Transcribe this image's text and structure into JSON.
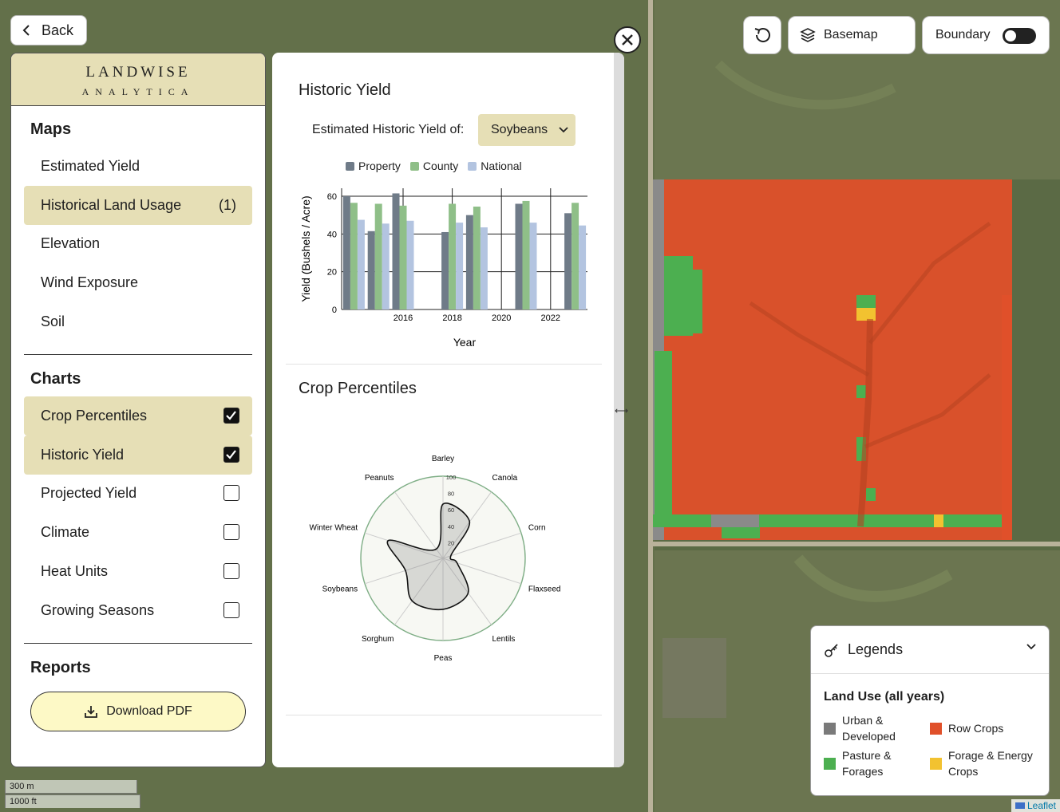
{
  "nav": {
    "back_label": "Back",
    "basemap_label": "Basemap",
    "boundary_label": "Boundary"
  },
  "logo": {
    "line1": "LANDWISE",
    "line2": "ANALYTICA"
  },
  "sidebar": {
    "maps_title": "Maps",
    "maps": [
      {
        "label": "Estimated Yield"
      },
      {
        "label": "Historical Land Usage",
        "count": "(1)",
        "active": true
      },
      {
        "label": "Elevation"
      },
      {
        "label": "Wind Exposure"
      },
      {
        "label": "Soil"
      }
    ],
    "charts_title": "Charts",
    "charts": [
      {
        "label": "Crop Percentiles",
        "checked": true
      },
      {
        "label": "Historic Yield",
        "checked": true
      },
      {
        "label": "Projected Yield",
        "checked": false
      },
      {
        "label": "Climate",
        "checked": false
      },
      {
        "label": "Heat Units",
        "checked": false
      },
      {
        "label": "Growing Seasons",
        "checked": false
      }
    ],
    "reports_title": "Reports",
    "download_label": "Download PDF"
  },
  "panel": {
    "historic_title": "Historic Yield",
    "estimate_label": "Estimated Historic Yield of:",
    "selected_crop": "Soybeans",
    "percentiles_title": "Crop Percentiles"
  },
  "chart_data": [
    {
      "type": "bar",
      "xlabel": "Year",
      "ylabel": "Yield (Bushels / Acre)",
      "ylim": [
        0,
        60
      ],
      "yticks": [
        0,
        20,
        40,
        60
      ],
      "xticks": [
        2016,
        2018,
        2020,
        2022
      ],
      "grid": true,
      "legend": "top",
      "categories": [
        2014,
        2015,
        2016,
        2017,
        2018,
        2019,
        2020,
        2021,
        2022,
        2023
      ],
      "series": [
        {
          "name": "Property",
          "color": "#6f7b88",
          "values": [
            60,
            41.5,
            61.5,
            null,
            41,
            50,
            null,
            56,
            null,
            51
          ]
        },
        {
          "name": "County",
          "color": "#8fbf88",
          "values": [
            56.5,
            56,
            55,
            null,
            56,
            54.5,
            null,
            57.5,
            null,
            56.5
          ]
        },
        {
          "name": "National",
          "color": "#b3c4e0",
          "values": [
            47.5,
            45.5,
            47,
            null,
            46,
            43.5,
            null,
            46,
            null,
            44.5
          ]
        }
      ]
    },
    {
      "type": "radar",
      "categories": [
        "Barley",
        "Canola",
        "Corn",
        "Flaxseed",
        "Lentils",
        "Peas",
        "Sorghum",
        "Soybeans",
        "Winter Wheat",
        "Peanuts"
      ],
      "values": [
        66,
        55,
        10,
        18,
        52,
        62,
        64,
        48,
        70,
        14
      ],
      "rlim": [
        0,
        100
      ],
      "rticks": [
        20,
        40,
        60,
        80,
        100
      ]
    }
  ],
  "legends": {
    "title": "Legends",
    "subtitle": "Land Use (all years)",
    "items": [
      {
        "label_lines": [
          "Urban &",
          "Developed"
        ],
        "color": "#7a7a7a"
      },
      {
        "label_lines": [
          "Row Crops"
        ],
        "color": "#e0502a"
      },
      {
        "label_lines": [
          "Pasture &",
          "Forages"
        ],
        "color": "#4caf50"
      },
      {
        "label_lines": [
          "Forage & Energy",
          "Crops"
        ],
        "color": "#f2c230"
      }
    ]
  },
  "scale": {
    "metric": "300 m",
    "imperial": "1000 ft"
  },
  "attribution": "Leaflet"
}
